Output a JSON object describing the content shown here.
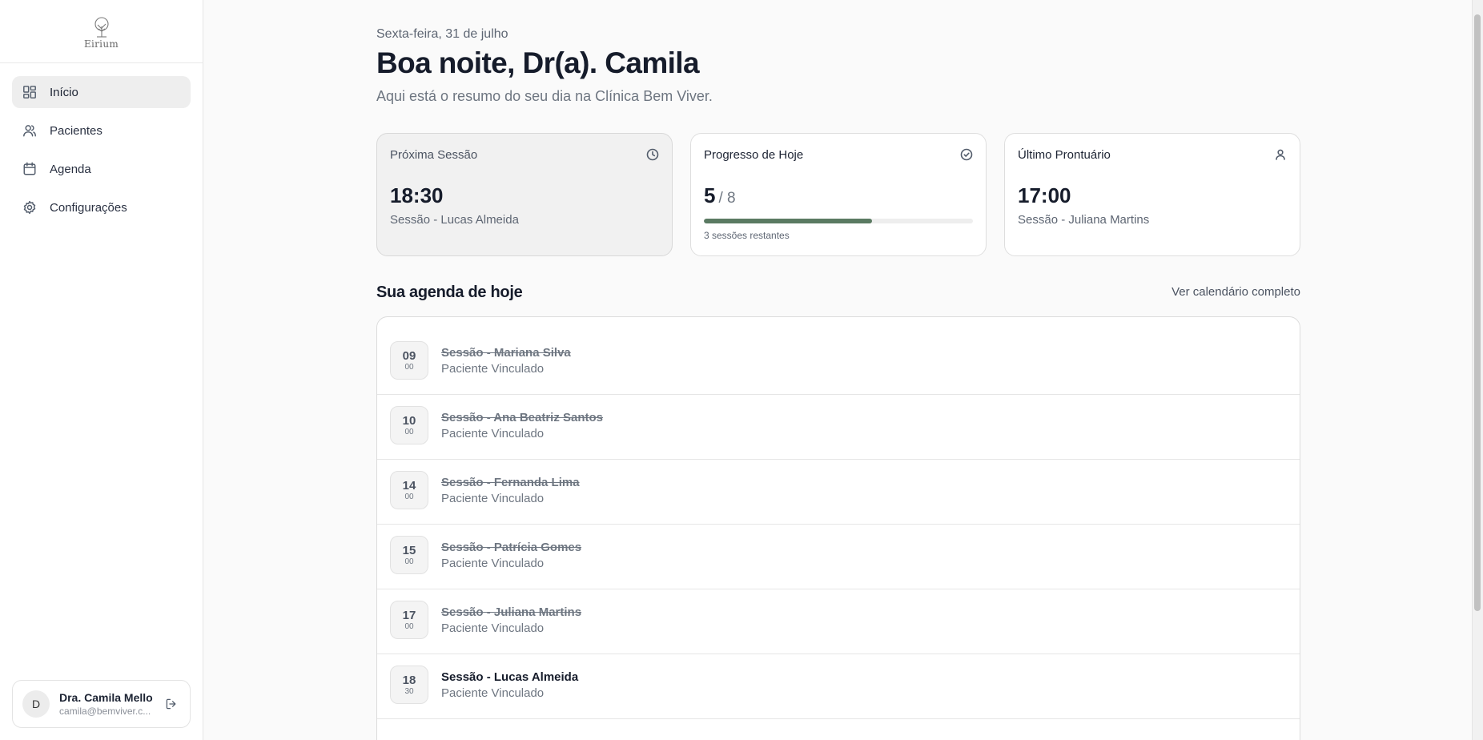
{
  "brand": {
    "name": "Eirium"
  },
  "sidebar": {
    "items": [
      {
        "label": "Início",
        "icon": "dashboard-icon",
        "active": true
      },
      {
        "label": "Pacientes",
        "icon": "users-icon",
        "active": false
      },
      {
        "label": "Agenda",
        "icon": "calendar-icon",
        "active": false
      },
      {
        "label": "Configurações",
        "icon": "gear-icon",
        "active": false
      }
    ],
    "user": {
      "initial": "D",
      "name": "Dra. Camila Mello",
      "email": "camila@bemviver.c..."
    }
  },
  "header": {
    "date": "Sexta-feira, 31 de julho",
    "greeting": "Boa noite, Dr(a). Camila",
    "subtitle": "Aqui está o resumo do seu dia na Clínica Bem Viver."
  },
  "cards": {
    "next_session": {
      "title": "Próxima Sessão",
      "icon": "clock-icon",
      "value": "18:30",
      "sub": "Sessão - Lucas Almeida"
    },
    "progress": {
      "title": "Progresso de Hoje",
      "icon": "check-circle-icon",
      "done": "5",
      "total": "/ 8",
      "fraction": 0.625,
      "label": "3 sessões restantes"
    },
    "last_record": {
      "title": "Último Prontuário",
      "icon": "user-icon",
      "value": "17:00",
      "sub": "Sessão - Juliana Martins"
    }
  },
  "agenda": {
    "title": "Sua agenda de hoje",
    "link": "Ver calendário completo",
    "rows": [
      {
        "hour": "09",
        "min": "00",
        "title": "Sessão - Mariana Silva",
        "sub": "Paciente Vinculado",
        "done": true
      },
      {
        "hour": "10",
        "min": "00",
        "title": "Sessão - Ana Beatriz Santos",
        "sub": "Paciente Vinculado",
        "done": true
      },
      {
        "hour": "14",
        "min": "00",
        "title": "Sessão - Fernanda Lima",
        "sub": "Paciente Vinculado",
        "done": true
      },
      {
        "hour": "15",
        "min": "00",
        "title": "Sessão - Patrícia Gomes",
        "sub": "Paciente Vinculado",
        "done": true
      },
      {
        "hour": "17",
        "min": "00",
        "title": "Sessão - Juliana Martins",
        "sub": "Paciente Vinculado",
        "done": true
      },
      {
        "hour": "18",
        "min": "30",
        "title": "Sessão - Lucas Almeida",
        "sub": "Paciente Vinculado",
        "done": false
      }
    ]
  },
  "colors": {
    "accent": "#5a7a62",
    "active_nav": "#eeeeee"
  }
}
